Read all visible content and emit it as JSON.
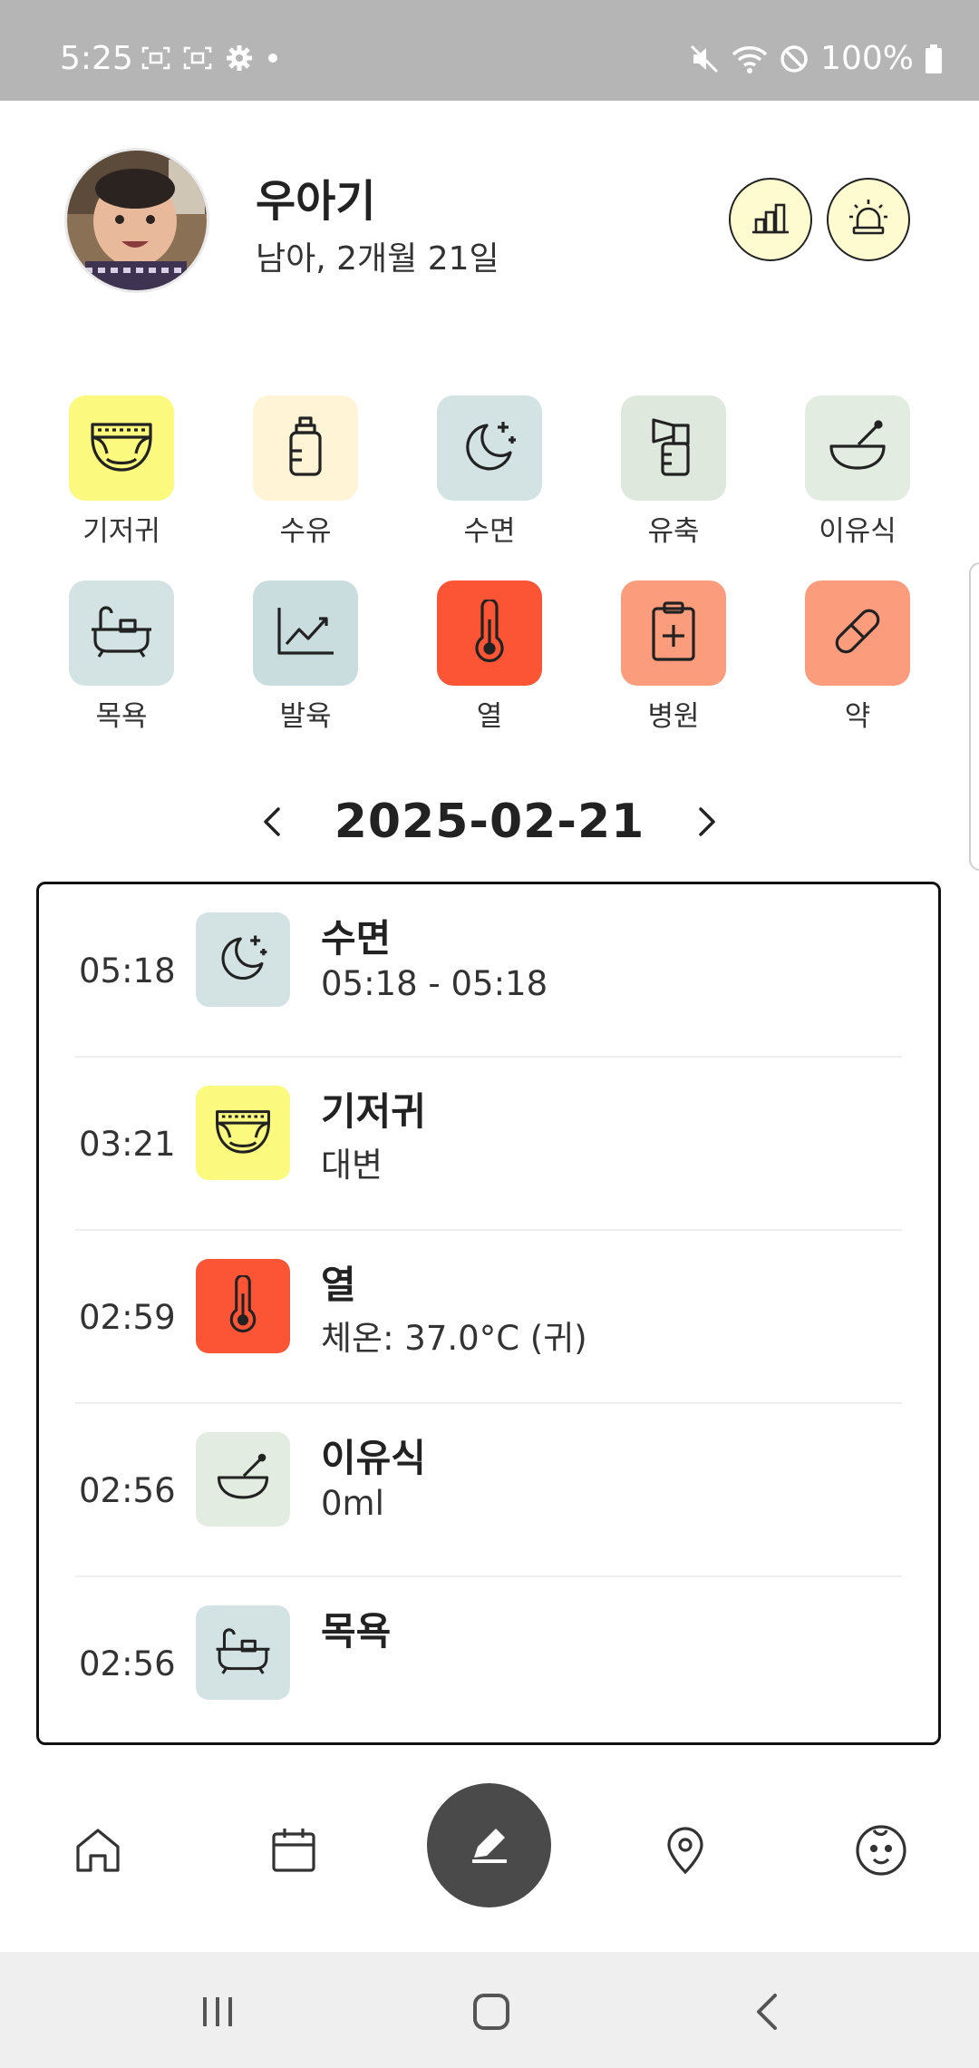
{
  "status": {
    "time": "5:25",
    "battery": "100%"
  },
  "profile": {
    "name": "우아기",
    "sub": "남아, 2개월 21일"
  },
  "categories": [
    {
      "label": "기저귀",
      "icon": "diaper-icon",
      "color": "#fbfa7e"
    },
    {
      "label": "수유",
      "icon": "bottle-icon",
      "color": "#fff5d6"
    },
    {
      "label": "수면",
      "icon": "moon-icon",
      "color": "#d3e3e4"
    },
    {
      "label": "유축",
      "icon": "breast-pump-icon",
      "color": "#dfe8dc"
    },
    {
      "label": "이유식",
      "icon": "bowl-icon",
      "color": "#e3ece1"
    },
    {
      "label": "목욕",
      "icon": "bathtub-icon",
      "color": "#d3e3e4"
    },
    {
      "label": "발육",
      "icon": "growth-chart-icon",
      "color": "#c9dcde"
    },
    {
      "label": "열",
      "icon": "thermometer-icon",
      "color": "#fb5535"
    },
    {
      "label": "병원",
      "icon": "clipboard-plus-icon",
      "color": "#fb9d7d"
    },
    {
      "label": "약",
      "icon": "pill-icon",
      "color": "#fb9d7d"
    }
  ],
  "date_nav": {
    "date": "2025-02-21"
  },
  "logs": [
    {
      "time": "05:18",
      "title": "수면",
      "detail": "05:18 - 05:18",
      "icon": "moon-icon",
      "color": "#d3e3e4"
    },
    {
      "time": "03:21",
      "title": "기저귀",
      "detail": "대변",
      "icon": "diaper-icon",
      "color": "#fbfa7e"
    },
    {
      "time": "02:59",
      "title": "열",
      "detail": "체온: 37.0°C (귀)",
      "icon": "thermometer-icon",
      "color": "#fb5535"
    },
    {
      "time": "02:56",
      "title": "이유식",
      "detail": "0ml",
      "icon": "bowl-icon",
      "color": "#e3ece1"
    },
    {
      "time": "02:56",
      "title": "목욕",
      "detail": "",
      "icon": "bathtub-icon",
      "color": "#d3e3e4"
    }
  ],
  "bottom_nav": [
    "home-icon",
    "calendar-icon",
    "edit-icon",
    "location-pin-icon",
    "baby-face-icon"
  ]
}
